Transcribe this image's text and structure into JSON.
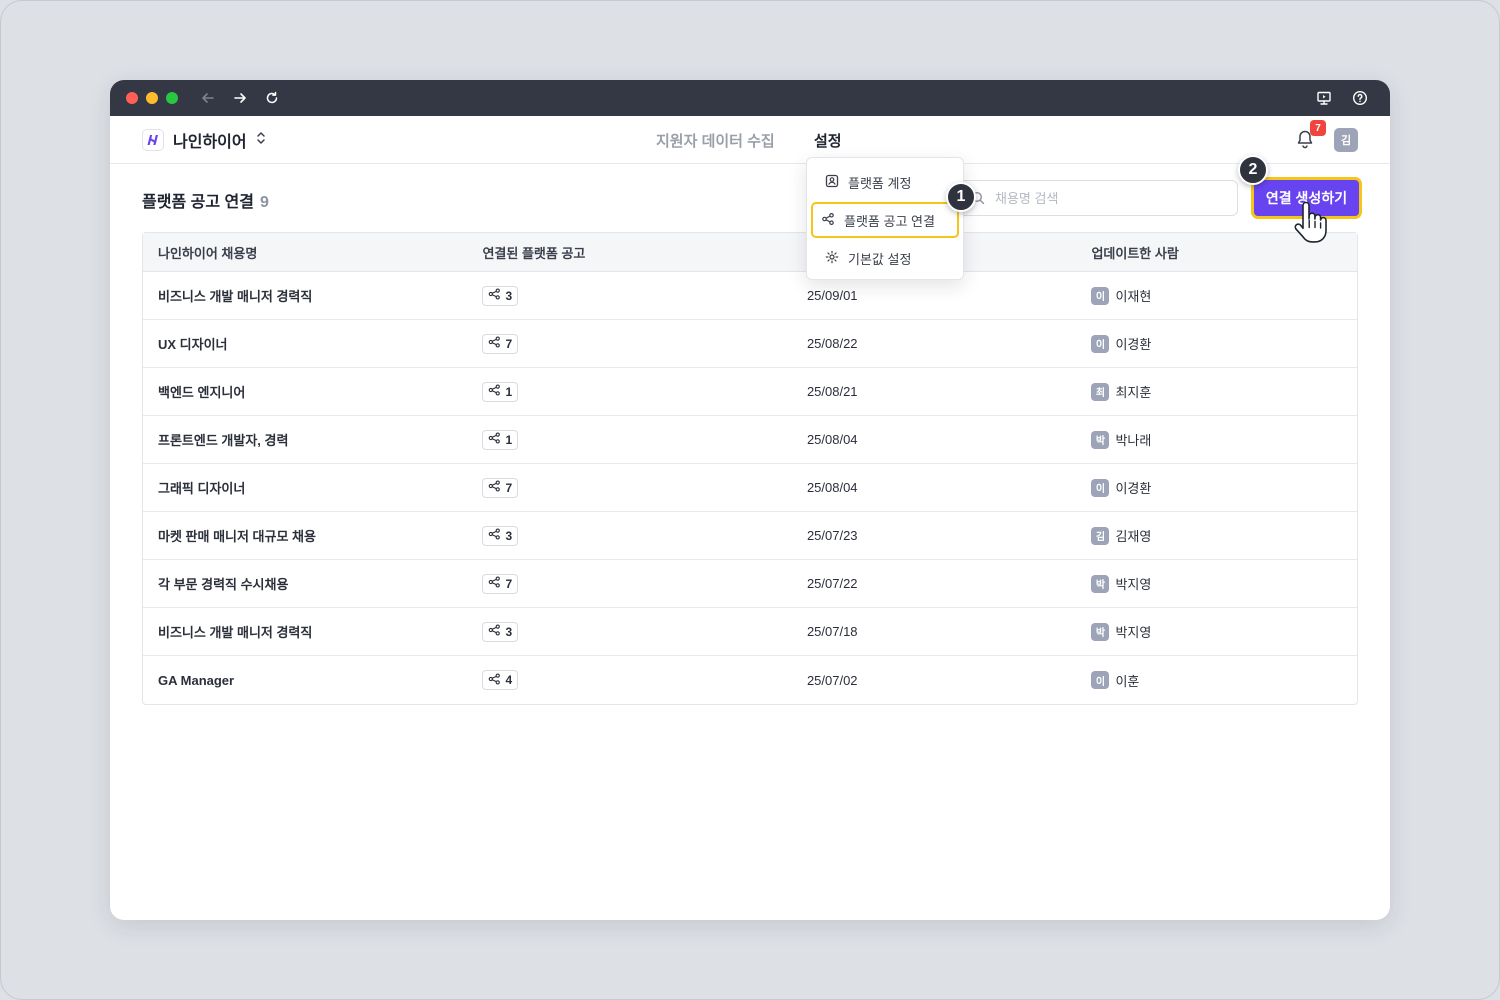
{
  "titlebar": {
    "icons": [
      "back-arrow-icon",
      "forward-arrow-icon",
      "refresh-icon",
      "screen-icon",
      "help-icon"
    ]
  },
  "header": {
    "brand_name": "나인하이어",
    "nav_tabs": [
      "지원자 데이터 수집",
      "설정"
    ],
    "notification_count": "7",
    "user_avatar": "김"
  },
  "page": {
    "title": "플랫폼 공고 연결",
    "count": "9"
  },
  "search": {
    "placeholder": "채용명 검색",
    "value": ""
  },
  "create_button": "연결 생성하기",
  "steps": [
    "1",
    "2"
  ],
  "dropdown": {
    "items": [
      "플랫폼 계정",
      "플랫폼 공고 연결",
      "기본값 설정"
    ]
  },
  "table": {
    "headers": [
      "나인하이어 채용명",
      "연결된 플랫폼 공고",
      "",
      "업데이트한 사람"
    ],
    "rows": [
      {
        "title": "비즈니스 개발 매니저 경력직",
        "links": "3",
        "date": "25/09/01",
        "avatar": "이",
        "user": "이재현"
      },
      {
        "title": "UX 디자이너",
        "links": "7",
        "date": "25/08/22",
        "avatar": "이",
        "user": "이경환"
      },
      {
        "title": "백엔드 엔지니어",
        "links": "1",
        "date": "25/08/21",
        "avatar": "최",
        "user": "최지훈"
      },
      {
        "title": "프론트엔드 개발자, 경력",
        "links": "1",
        "date": "25/08/04",
        "avatar": "박",
        "user": "박나래"
      },
      {
        "title": "그래픽 디자이너",
        "links": "7",
        "date": "25/08/04",
        "avatar": "이",
        "user": "이경환"
      },
      {
        "title": "마켓 판매 매니저 대규모 채용",
        "links": "3",
        "date": "25/07/23",
        "avatar": "김",
        "user": "김재영"
      },
      {
        "title": "각 부문 경력직 수시채용",
        "links": "7",
        "date": "25/07/22",
        "avatar": "박",
        "user": "박지영"
      },
      {
        "title": "비즈니스 개발 매니저 경력직",
        "links": "3",
        "date": "25/07/18",
        "avatar": "박",
        "user": "박지영"
      },
      {
        "title": "GA Manager",
        "links": "4",
        "date": "25/07/02",
        "avatar": "이",
        "user": "이훈"
      }
    ]
  },
  "colors": {
    "primary": "#6744f0",
    "highlight": "#f5c518",
    "titlebar": "#333844",
    "badge": "#f0453f"
  }
}
